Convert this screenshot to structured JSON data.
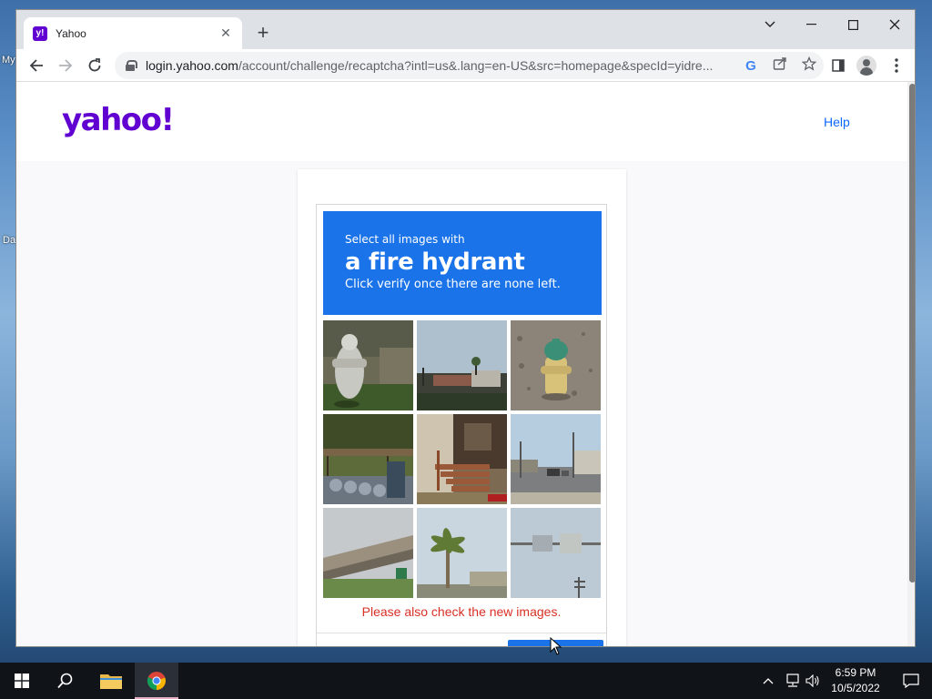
{
  "desktop": {
    "label_a": "My",
    "label_b": "Da"
  },
  "browser": {
    "tab": {
      "favicon": "y!",
      "title": "Yahoo",
      "close_icon": "close-icon"
    },
    "new_tab": "+",
    "url_host": "login.yahoo.com",
    "url_rest": "/account/challenge/recaptcha?intl=us&.lang=en-US&src=homepage&specId=yidre...",
    "icons": [
      "back-icon",
      "forward-icon",
      "reload-icon",
      "lock-icon",
      "google-icon",
      "share-icon",
      "star-icon",
      "side-panel-icon",
      "profile-icon",
      "menu-icon"
    ]
  },
  "page": {
    "logo": "yahoo!",
    "help": "Help",
    "brand_color": "#6001d2"
  },
  "recaptcha": {
    "line1": "Select all images with",
    "line2": "a fire hydrant",
    "line3": "Click verify once there are none left.",
    "error": "Please also check the new images.",
    "accent": "#1a73e8",
    "tiles": [
      "fire hydrant close-up",
      "street with buildings",
      "fire hydrant on gravel",
      "bike rack with trees",
      "house porch stairs",
      "street intersection",
      "overpass and grass",
      "palm tree",
      "street sign"
    ]
  },
  "taskbar": {
    "time": "6:59 PM",
    "date": "10/5/2022"
  }
}
